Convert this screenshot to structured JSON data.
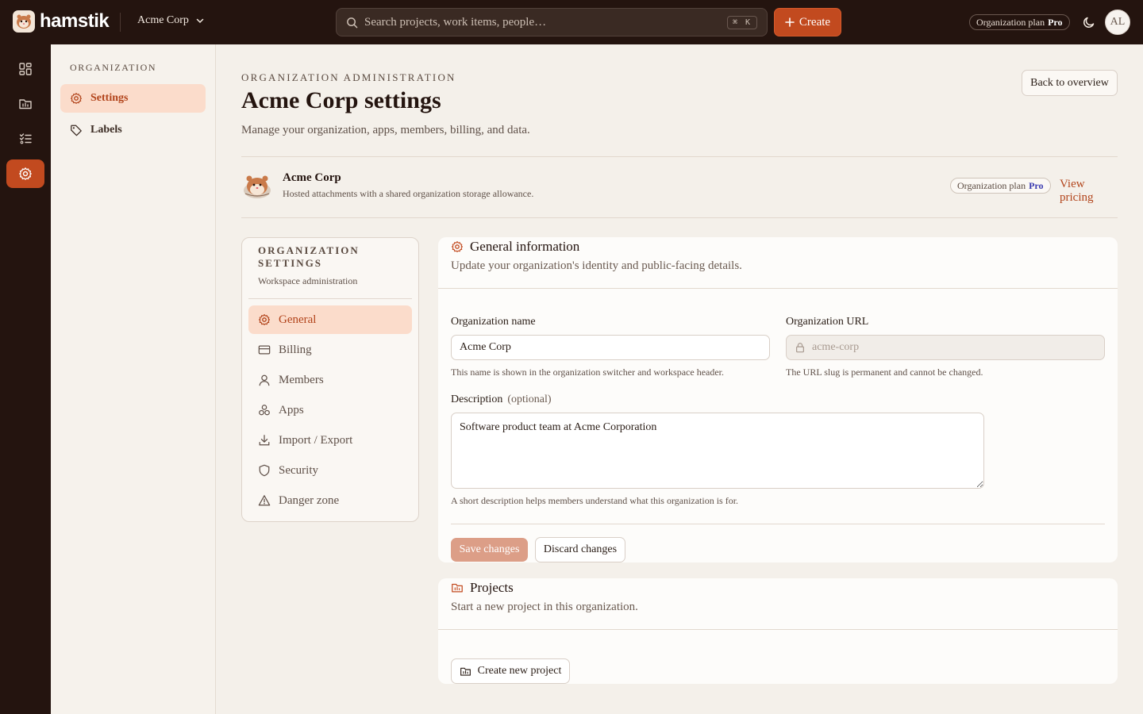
{
  "app": {
    "brand": "hamstik",
    "org_name": "Acme Corp"
  },
  "topbar": {
    "search_placeholder": "Search projects, work items, people…",
    "search_shortcut": "⌘ K",
    "create_label": "Create",
    "plan_label": "Organization plan",
    "plan_value": "Pro",
    "avatar_initials": "AL"
  },
  "rail": {
    "items": [
      "dashboard-icon",
      "projects-icon",
      "work-items-icon",
      "settings-icon"
    ],
    "active": "settings-icon"
  },
  "sidebar": {
    "heading": "ORGANIZATION",
    "items": [
      {
        "label": "Settings",
        "icon": "gear-icon",
        "active": true
      },
      {
        "label": "Labels",
        "icon": "tag-icon",
        "active": false
      }
    ]
  },
  "header": {
    "eyebrow": "ORGANIZATION ADMINISTRATION",
    "title": "Acme Corp settings",
    "subtitle": "Manage your organization, apps, members, billing, and data.",
    "back_label": "Back to overview"
  },
  "org_card": {
    "name": "Acme Corp",
    "description": "Hosted attachments with a shared organization storage allowance.",
    "plan_label": "Organization plan",
    "plan_value": "Pro",
    "pricing_link": "View pricing"
  },
  "settings_nav": {
    "title": "ORGANIZATION SETTINGS",
    "subtitle": "Workspace administration",
    "items": [
      {
        "label": "General",
        "icon": "gear-icon",
        "active": true
      },
      {
        "label": "Billing",
        "icon": "credit-card-icon",
        "active": false
      },
      {
        "label": "Members",
        "icon": "user-icon",
        "active": false
      },
      {
        "label": "Apps",
        "icon": "apps-icon",
        "active": false
      },
      {
        "label": "Import / Export",
        "icon": "download-icon",
        "active": false
      },
      {
        "label": "Security",
        "icon": "shield-icon",
        "active": false
      },
      {
        "label": "Danger zone",
        "icon": "warning-icon",
        "active": false
      }
    ]
  },
  "general": {
    "title": "General information",
    "subtitle": "Update your organization's identity and public-facing details.",
    "name_label": "Organization name",
    "name_value": "Acme Corp",
    "name_hint": "This name is shown in the organization switcher and workspace header.",
    "url_label": "Organization URL",
    "url_value": "acme-corp",
    "url_hint": "The URL slug is permanent and cannot be changed.",
    "desc_label": "Description",
    "desc_optional": "(optional)",
    "desc_value": "Software product team at Acme Corporation",
    "desc_hint": "A short description helps members understand what this organization is for.",
    "save_label": "Save changes",
    "discard_label": "Discard changes"
  },
  "projects": {
    "title": "Projects",
    "subtitle": "Start a new project in this organization.",
    "create_label": "Create new project"
  },
  "colors": {
    "accent": "#c24a1f",
    "topbar": "#24140f",
    "active_bg": "#fbdccb",
    "pro": "#3b3bb0"
  }
}
